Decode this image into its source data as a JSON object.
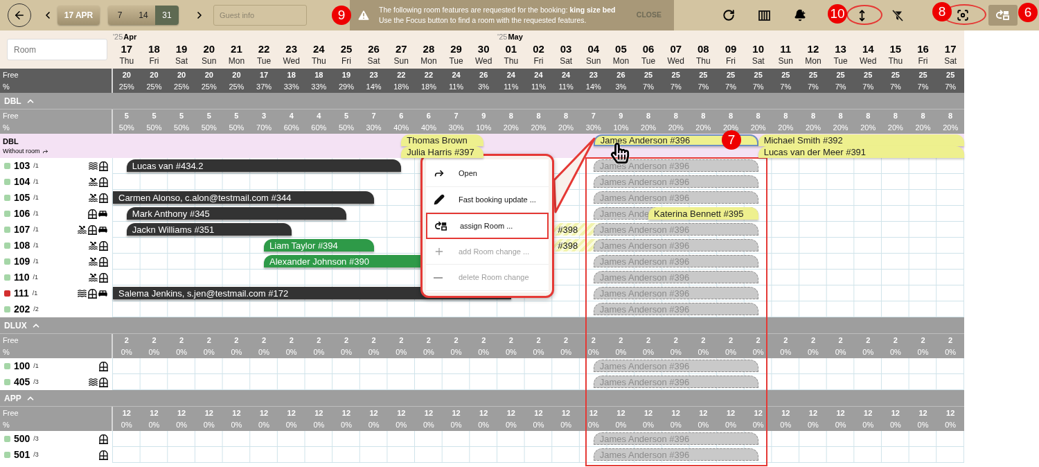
{
  "toolbar": {
    "date_button": "17 APR",
    "ranges": [
      {
        "label": "7",
        "selected": false
      },
      {
        "label": "14",
        "selected": false
      },
      {
        "label": "31",
        "selected": true
      }
    ],
    "guest_placeholder": "Guest info"
  },
  "banner": {
    "line1": "The following room features are requested for the booking: **king size bed**",
    "line2": "Use the Focus button to find a room with the requested features.",
    "close": "CLOSE"
  },
  "room_search_placeholder": "Room",
  "days": [
    {
      "day": "17",
      "weekday": "Thu",
      "month": {
        "year": "'25",
        "name": "Apr"
      }
    },
    {
      "day": "18",
      "weekday": "Fri"
    },
    {
      "day": "19",
      "weekday": "Sat"
    },
    {
      "day": "20",
      "weekday": "Sun"
    },
    {
      "day": "21",
      "weekday": "Mon"
    },
    {
      "day": "22",
      "weekday": "Tue"
    },
    {
      "day": "23",
      "weekday": "Wed"
    },
    {
      "day": "24",
      "weekday": "Thu"
    },
    {
      "day": "25",
      "weekday": "Fri"
    },
    {
      "day": "26",
      "weekday": "Sat"
    },
    {
      "day": "27",
      "weekday": "Sun"
    },
    {
      "day": "28",
      "weekday": "Mon"
    },
    {
      "day": "29",
      "weekday": "Tue"
    },
    {
      "day": "30",
      "weekday": "Wed"
    },
    {
      "day": "01",
      "weekday": "Thu",
      "month": {
        "year": "'25",
        "name": "May"
      }
    },
    {
      "day": "02",
      "weekday": "Fri"
    },
    {
      "day": "03",
      "weekday": "Sat"
    },
    {
      "day": "04",
      "weekday": "Sun"
    },
    {
      "day": "05",
      "weekday": "Mon"
    },
    {
      "day": "06",
      "weekday": "Tue"
    },
    {
      "day": "07",
      "weekday": "Wed"
    },
    {
      "day": "08",
      "weekday": "Thu"
    },
    {
      "day": "09",
      "weekday": "Fri"
    },
    {
      "day": "10",
      "weekday": "Sat"
    },
    {
      "day": "11",
      "weekday": "Sun"
    },
    {
      "day": "12",
      "weekday": "Mon"
    },
    {
      "day": "13",
      "weekday": "Tue"
    },
    {
      "day": "14",
      "weekday": "Wed"
    },
    {
      "day": "15",
      "weekday": "Thu"
    },
    {
      "day": "16",
      "weekday": "Fri"
    },
    {
      "day": "17",
      "weekday": "Sat"
    }
  ],
  "total": {
    "free_label": "Free",
    "pct_label": "%",
    "free": [
      "20",
      "20",
      "20",
      "20",
      "20",
      "17",
      "18",
      "18",
      "19",
      "23",
      "22",
      "22",
      "24",
      "26",
      "24",
      "24",
      "24",
      "23",
      "26",
      "25",
      "25",
      "25",
      "25",
      "25",
      "25",
      "25",
      "25",
      "25",
      "25",
      "25",
      "25"
    ],
    "pct": [
      "25%",
      "25%",
      "25%",
      "25%",
      "25%",
      "37%",
      "33%",
      "33%",
      "29%",
      "14%",
      "18%",
      "18%",
      "11%",
      "3%",
      "11%",
      "11%",
      "11%",
      "14%",
      "3%",
      "7%",
      "7%",
      "7%",
      "7%",
      "7%",
      "7%",
      "7%",
      "7%",
      "7%",
      "7%",
      "7%",
      "7%"
    ]
  },
  "groups": [
    {
      "name": "DBL",
      "expanded": true,
      "free_label": "Free",
      "pct_label": "%",
      "free": [
        "5",
        "5",
        "5",
        "5",
        "5",
        "3",
        "4",
        "4",
        "5",
        "7",
        "6",
        "6",
        "7",
        "9",
        "8",
        "8",
        "8",
        "7",
        "9",
        "8",
        "8",
        "8",
        "8",
        "8",
        "8",
        "8",
        "8",
        "8",
        "8",
        "8",
        "8"
      ],
      "pct": [
        "50%",
        "50%",
        "50%",
        "50%",
        "50%",
        "70%",
        "60%",
        "60%",
        "50%",
        "30%",
        "40%",
        "40%",
        "30%",
        "10%",
        "20%",
        "20%",
        "20%",
        "30%",
        "10%",
        "20%",
        "20%",
        "20%",
        "20%",
        "20%",
        "20%",
        "20%",
        "20%",
        "20%",
        "20%",
        "20%",
        "20%"
      ],
      "without_room": {
        "title": "DBL",
        "subtitle": "Without room",
        "bookings": [
          {
            "guest": "Thomas Brown",
            "selected": false
          },
          {
            "guest": "Julia Harris #397",
            "selected": false
          },
          {
            "guest": "James Anderson #396",
            "selected": true
          },
          {
            "guest": "Michael Smith #392",
            "selected": false
          },
          {
            "guest": "Lucas van der Meer #391",
            "selected": false
          }
        ]
      },
      "rooms": [
        {
          "number": "103",
          "capacity": "/1",
          "color": "#a5d6a7",
          "features": [
            {
              "kind": "waves"
            },
            {
              "kind": "window"
            }
          ],
          "bookings": [
            {
              "guest": "Lucas van #434.2",
              "kind": "booked"
            },
            {
              "guest": "James Anderson #396",
              "kind": "suggestion"
            }
          ]
        },
        {
          "number": "104",
          "capacity": "/1",
          "color": "#a5d6a7",
          "features": [
            {
              "kind": "pool"
            },
            {
              "kind": "window"
            }
          ],
          "bookings": [
            {
              "guest": "James Anderson #396",
              "kind": "suggestion"
            }
          ]
        },
        {
          "number": "105",
          "capacity": "/1",
          "color": "#a5d6a7",
          "features": [
            {
              "kind": "pool"
            },
            {
              "kind": "window"
            }
          ],
          "bookings": [
            {
              "guest": "Carmen Alonso, c.alon@testmail.com #344",
              "kind": "booked"
            },
            {
              "guest": "James Anderson #396",
              "kind": "suggestion"
            }
          ]
        },
        {
          "number": "106",
          "capacity": "/1",
          "color": "#a5d6a7",
          "features": [
            {
              "kind": "window"
            },
            {
              "kind": "bed"
            }
          ],
          "bookings": [
            {
              "guest": "Mark Anthony #345",
              "kind": "booked"
            },
            {
              "guest": "James Ande",
              "kind": "suggestion"
            },
            {
              "guest": "Katerina Bennett #395",
              "kind": "pending"
            }
          ]
        },
        {
          "number": "107",
          "capacity": "/1",
          "color": "#a5d6a7",
          "features": [
            {
              "kind": "pool"
            },
            {
              "kind": "window"
            },
            {
              "kind": "bed"
            }
          ],
          "bookings": [
            {
              "guest": "Jackn Williams #351",
              "kind": "booked"
            },
            {
              "guest": "#398",
              "kind": "tentative"
            },
            {
              "guest": "James Anderson #396",
              "kind": "suggestion"
            }
          ]
        },
        {
          "number": "108",
          "capacity": "/1",
          "color": "#a5d6a7",
          "features": [
            {
              "kind": "pool"
            },
            {
              "kind": "window"
            }
          ],
          "bookings": [
            {
              "guest": "Liam Taylor #394",
              "kind": "arrived"
            },
            {
              "guest": "#398",
              "kind": "tentative"
            },
            {
              "guest": "James Anderson #396",
              "kind": "suggestion"
            }
          ]
        },
        {
          "number": "109",
          "capacity": "/1",
          "color": "#a5d6a7",
          "features": [
            {
              "kind": "pool"
            },
            {
              "kind": "window"
            }
          ],
          "bookings": [
            {
              "guest": "Alexander Johnson #390",
              "kind": "arrived"
            },
            {
              "guest": "James Anderson #396",
              "kind": "suggestion"
            }
          ]
        },
        {
          "number": "110",
          "capacity": "/1",
          "color": "#a5d6a7",
          "features": [
            {
              "kind": "pool"
            },
            {
              "kind": "window"
            }
          ],
          "bookings": [
            {
              "guest": "James Anderson #396",
              "kind": "suggestion"
            }
          ]
        },
        {
          "number": "111",
          "capacity": "/1",
          "color": "#d32f2f",
          "features": [
            {
              "kind": "waves"
            },
            {
              "kind": "window"
            },
            {
              "kind": "bed"
            }
          ],
          "bookings": [
            {
              "guest": "Salema Jenkins, s.jen@testmail.com #172",
              "kind": "booked"
            },
            {
              "guest": "James Anderson #396",
              "kind": "suggestion"
            }
          ]
        },
        {
          "number": "202",
          "capacity": "/2",
          "color": "#a5d6a7",
          "bookings": [
            {
              "guest": "James Anderson #396",
              "kind": "suggestion"
            }
          ]
        }
      ]
    },
    {
      "name": "DLUX",
      "expanded": true,
      "free_label": "Free",
      "pct_label": "%",
      "free": [
        "2",
        "2",
        "2",
        "2",
        "2",
        "2",
        "2",
        "2",
        "2",
        "2",
        "2",
        "2",
        "2",
        "2",
        "2",
        "2",
        "2",
        "2",
        "2",
        "2",
        "2",
        "2",
        "2",
        "2",
        "2",
        "2",
        "2",
        "2",
        "2",
        "2",
        "2"
      ],
      "pct": [
        "0%",
        "0%",
        "0%",
        "0%",
        "0%",
        "0%",
        "0%",
        "0%",
        "0%",
        "0%",
        "0%",
        "0%",
        "0%",
        "0%",
        "0%",
        "0%",
        "0%",
        "0%",
        "0%",
        "0%",
        "0%",
        "0%",
        "0%",
        "0%",
        "0%",
        "0%",
        "0%",
        "0%",
        "0%",
        "0%",
        "0%"
      ],
      "rooms": [
        {
          "number": "100",
          "capacity": "/1",
          "color": "#a5d6a7",
          "features": [
            {
              "kind": "window"
            }
          ],
          "bookings": [
            {
              "guest": "James Anderson #396",
              "kind": "suggestion"
            }
          ]
        },
        {
          "number": "405",
          "capacity": "/3",
          "color": "#a5d6a7",
          "features": [
            {
              "kind": "waves"
            },
            {
              "kind": "window"
            }
          ],
          "bookings": [
            {
              "guest": "James Anderson #396",
              "kind": "suggestion"
            }
          ]
        }
      ]
    },
    {
      "name": "APP",
      "expanded": true,
      "free_label": "Free",
      "pct_label": "%",
      "free": [
        "12",
        "12",
        "12",
        "12",
        "12",
        "12",
        "12",
        "12",
        "12",
        "12",
        "12",
        "12",
        "12",
        "12",
        "12",
        "12",
        "12",
        "12",
        "12",
        "12",
        "12",
        "12",
        "12",
        "12",
        "12",
        "12",
        "12",
        "12",
        "12",
        "12",
        "12"
      ],
      "pct": [
        "0%",
        "0%",
        "0%",
        "0%",
        "0%",
        "0%",
        "0%",
        "0%",
        "0%",
        "0%",
        "0%",
        "0%",
        "0%",
        "0%",
        "0%",
        "0%",
        "0%",
        "0%",
        "0%",
        "0%",
        "0%",
        "0%",
        "0%",
        "0%",
        "0%",
        "0%",
        "0%",
        "0%",
        "0%",
        "0%",
        "0%"
      ],
      "rooms": [
        {
          "number": "500",
          "capacity": "/3",
          "color": "#a5d6a7",
          "features": [
            {
              "kind": "window"
            }
          ],
          "bookings": [
            {
              "guest": "James Anderson #396",
              "kind": "suggestion"
            }
          ]
        },
        {
          "number": "501",
          "capacity": "/3",
          "color": "#a5d6a7",
          "features": [
            {
              "kind": "window"
            }
          ],
          "bookings": [
            {
              "guest": "James Anderson #396",
              "kind": "suggestion"
            }
          ]
        }
      ]
    }
  ],
  "context_menu": {
    "items": [
      {
        "label": "Open",
        "kind": "open",
        "disabled": false,
        "selected": false
      },
      {
        "label": "Fast booking update ...",
        "kind": "edit",
        "disabled": false,
        "selected": false
      },
      {
        "label": "assign Room ...",
        "kind": "assign",
        "disabled": false,
        "selected": true
      },
      {
        "label": "add Room change ...",
        "kind": "add",
        "disabled": true,
        "selected": false
      },
      {
        "label": "delete Room change",
        "kind": "remove",
        "disabled": true,
        "selected": false
      }
    ]
  },
  "annotations": [
    {
      "label": "9"
    },
    {
      "label": "10"
    },
    {
      "label": "8"
    },
    {
      "label": "6"
    },
    {
      "label": "7"
    }
  ]
}
